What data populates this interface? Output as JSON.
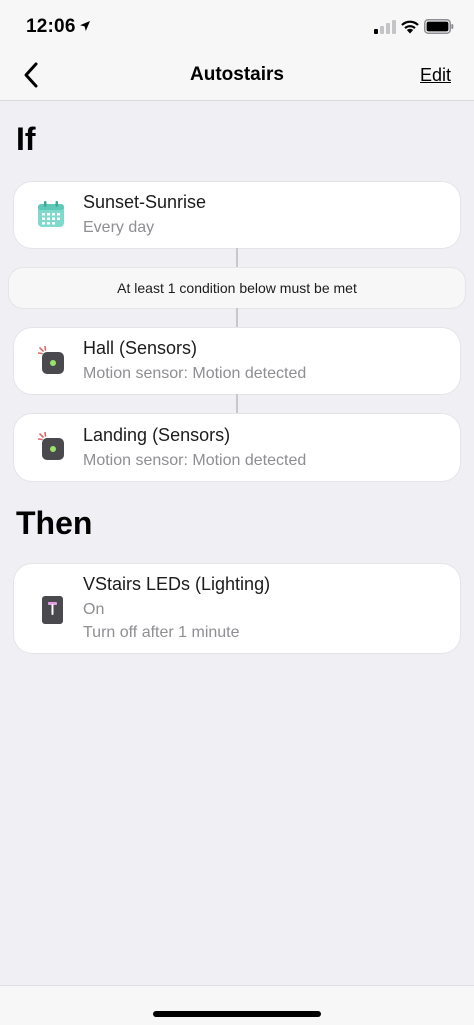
{
  "status_bar": {
    "time": "12:06",
    "icons": [
      "location-arrow-icon",
      "cellular-signal-icon",
      "wifi-icon",
      "battery-icon"
    ]
  },
  "nav": {
    "back_icon": "chevron-left-icon",
    "title": "Autostairs",
    "edit_label": "Edit"
  },
  "if_section": {
    "heading": "If",
    "trigger": {
      "icon": "calendar-icon",
      "title": "Sunset-Sunrise",
      "subtitle": "Every day"
    },
    "condition_note": "At least 1 condition below must be met",
    "conditions": [
      {
        "icon": "motion-sensor-icon",
        "title": "Hall (Sensors)",
        "subtitle": "Motion sensor: Motion detected"
      },
      {
        "icon": "motion-sensor-icon",
        "title": "Landing (Sensors)",
        "subtitle": "Motion sensor: Motion detected"
      }
    ]
  },
  "then_section": {
    "heading": "Then",
    "actions": [
      {
        "icon": "light-switch-icon",
        "title": "VStairs LEDs (Lighting)",
        "state": "On",
        "detail": "Turn off after 1 minute"
      }
    ]
  },
  "colors": {
    "background": "#efeff4",
    "calendar_teal": "#7fd9cc",
    "sensor_body": "#4a4a4e",
    "sensor_led": "#9be36a",
    "motion_red": "#e06a6a",
    "light_pink": "#e69be8"
  }
}
